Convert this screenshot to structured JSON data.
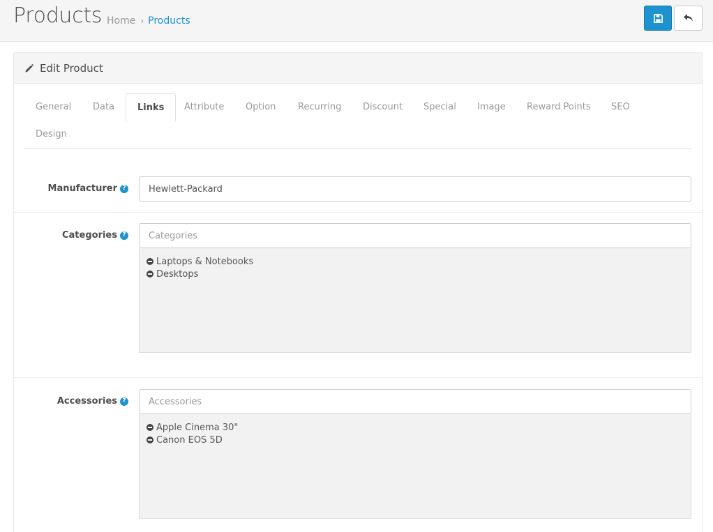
{
  "header": {
    "title": "Products",
    "breadcrumb": [
      {
        "label": "Home"
      },
      {
        "label": "Products"
      }
    ],
    "breadcrumb_sep": "›"
  },
  "panel": {
    "title": "Edit Product"
  },
  "tabs": [
    {
      "label": "General"
    },
    {
      "label": "Data"
    },
    {
      "label": "Links",
      "active": true
    },
    {
      "label": "Attribute"
    },
    {
      "label": "Option"
    },
    {
      "label": "Recurring"
    },
    {
      "label": "Discount"
    },
    {
      "label": "Special"
    },
    {
      "label": "Image"
    },
    {
      "label": "Reward Points"
    },
    {
      "label": "SEO"
    },
    {
      "label": "Design"
    }
  ],
  "form": {
    "manufacturer": {
      "label": "Manufacturer",
      "value": "Hewlett-Packard"
    },
    "categories": {
      "label": "Categories",
      "placeholder": "Categories",
      "items": [
        "Laptops & Notebooks",
        "Desktops"
      ]
    },
    "accessories": {
      "label": "Accessories",
      "placeholder": "Accessories",
      "items": [
        "Apple Cinema 30\"",
        "Canon EOS 5D"
      ]
    }
  },
  "help_glyph": "?",
  "icons": {
    "save": "floppy-disk-icon",
    "back": "reply-arrow-icon",
    "edit": "pencil-icon",
    "help": "question-circle-icon",
    "remove": "minus-circle-icon"
  },
  "colors": {
    "primary": "#1e91cf",
    "heading_bg": "#f5f5f5",
    "well_bg": "#f2f2f2"
  }
}
